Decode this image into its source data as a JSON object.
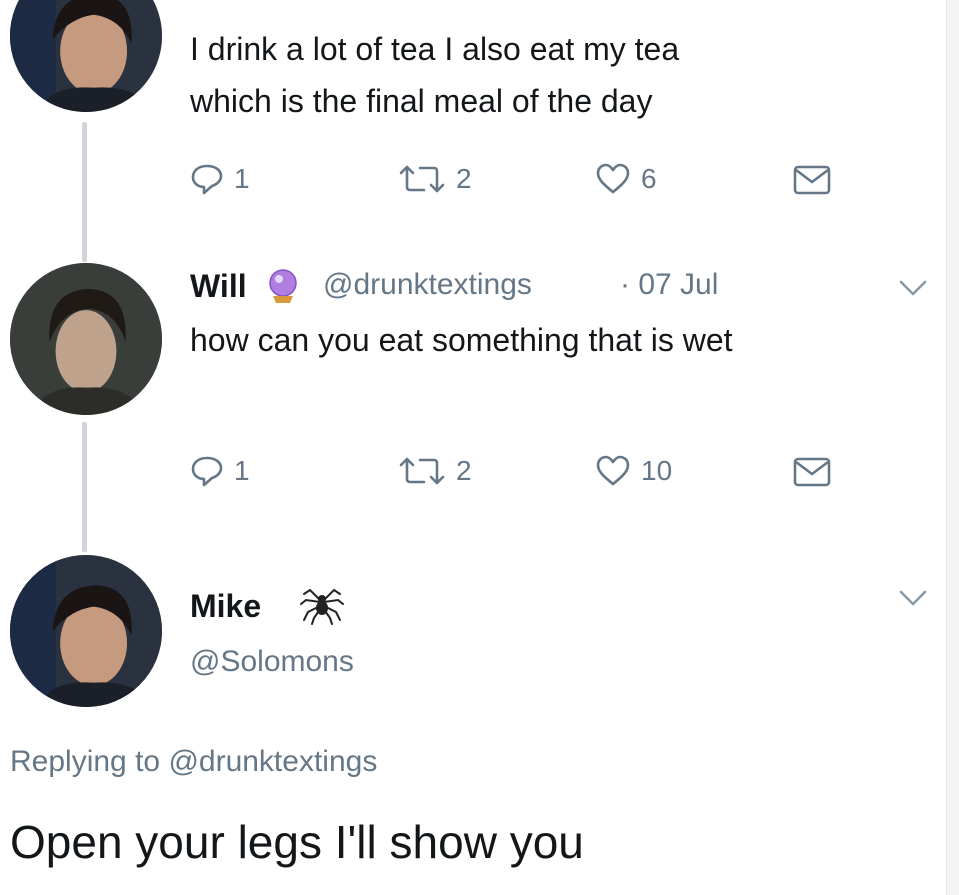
{
  "tweets": [
    {
      "text_lines": [
        "I drink a lot of tea I also eat my tea",
        "which is the final meal of the day"
      ],
      "actions": {
        "replies": "1",
        "retweets": "2",
        "likes": "6"
      },
      "icons": [
        "reply-icon",
        "retweet-icon",
        "heart-icon",
        "message-icon"
      ]
    },
    {
      "name": "Will",
      "emoji": "crystal-ball",
      "handle": "@drunktextings",
      "date": "· 07 Jul",
      "text": "how can you eat something that is wet",
      "actions": {
        "replies": "1",
        "retweets": "2",
        "likes": "10"
      },
      "icons": [
        "reply-icon",
        "retweet-icon",
        "heart-icon",
        "message-icon",
        "chevron-down-icon"
      ]
    },
    {
      "name": "Mike",
      "emoji": "spider",
      "handle": "@Solomons",
      "replying_to_prefix": "Replying to",
      "replying_to_handle": "@drunktextings",
      "text": "Open your legs I'll show you",
      "icons": [
        "chevron-down-icon"
      ]
    }
  ],
  "colors": {
    "text": "#14171a",
    "muted": "#657786",
    "link": "#1da1f2",
    "thread_line": "#cfd5da"
  }
}
